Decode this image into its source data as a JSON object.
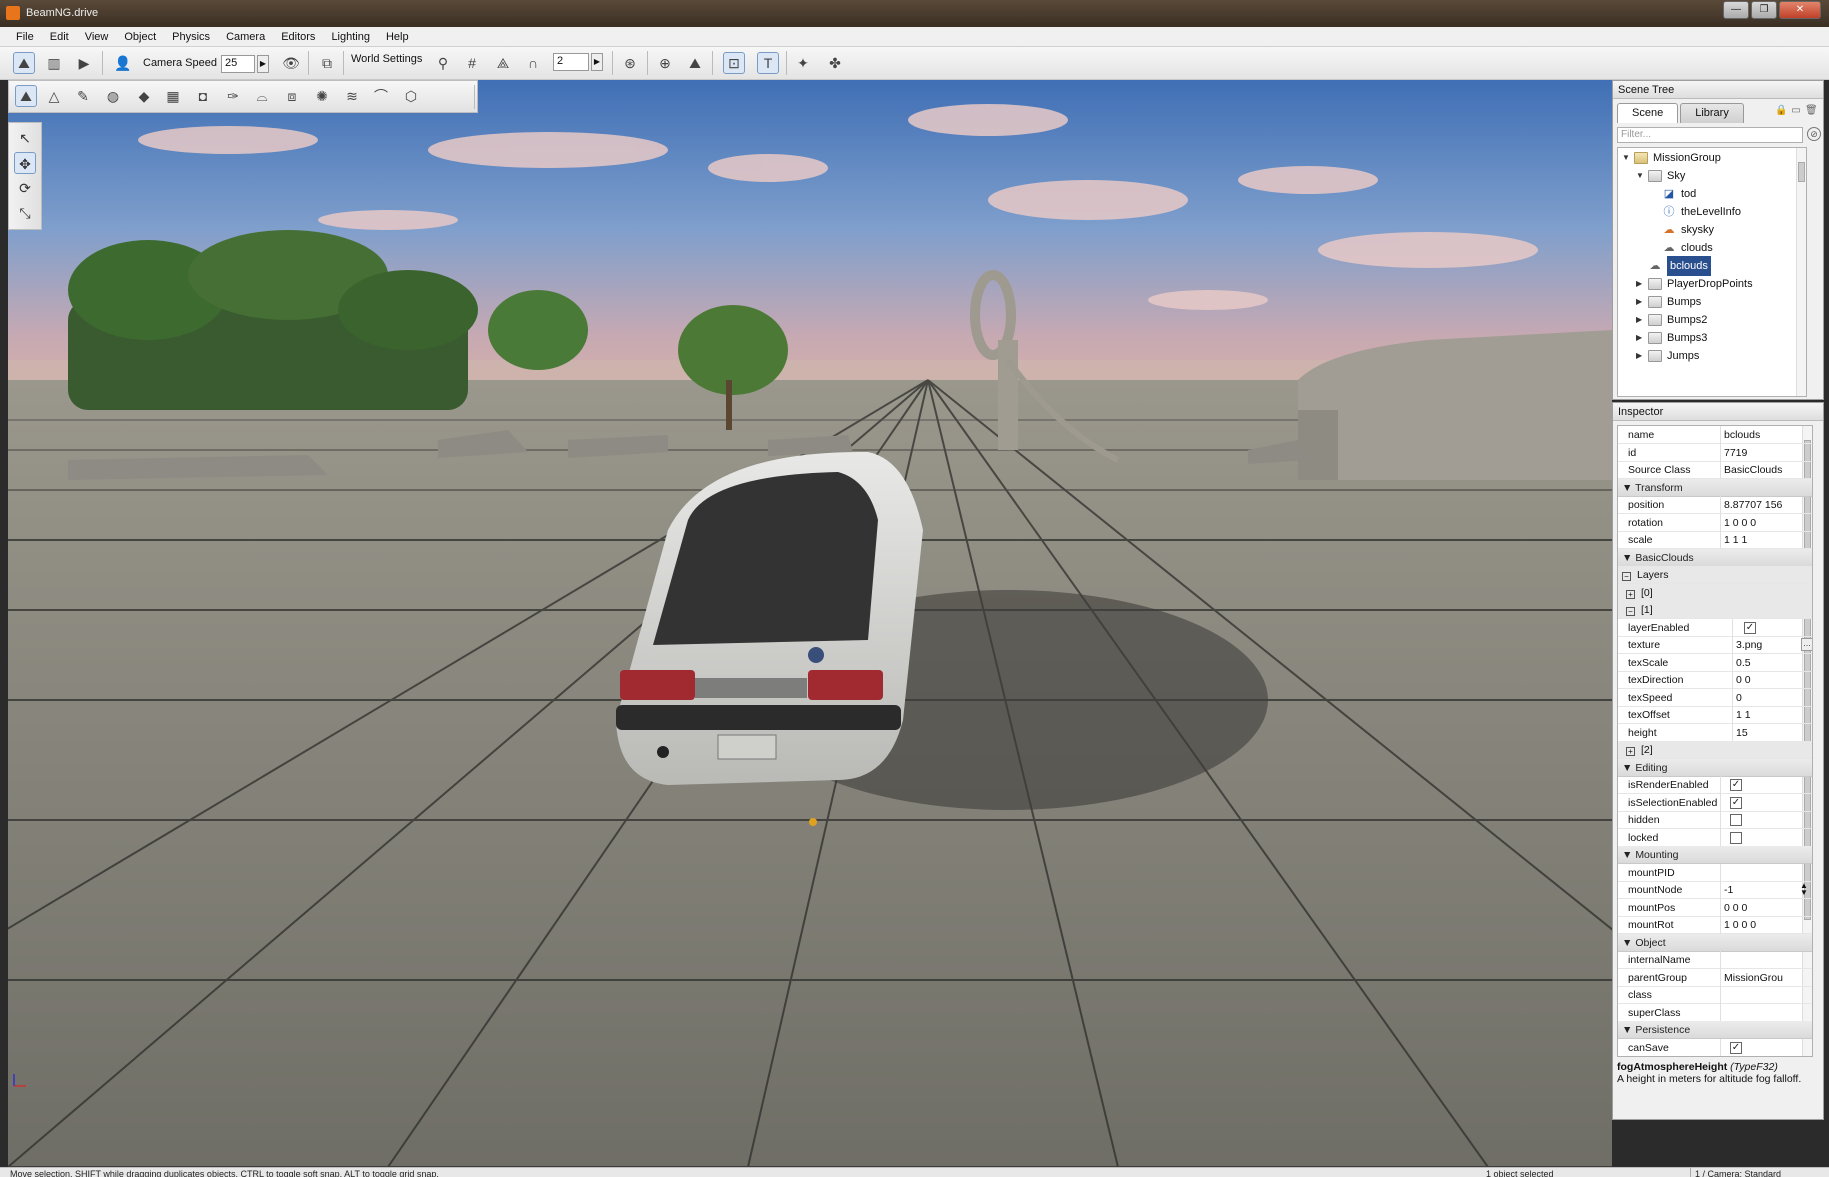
{
  "window": {
    "title": "BeamNG.drive",
    "min": "—",
    "max": "❐",
    "close": "✕"
  },
  "menu": [
    "File",
    "Edit",
    "View",
    "Object",
    "Physics",
    "Camera",
    "Editors",
    "Lighting",
    "Help"
  ],
  "toolbar": {
    "camera_speed_label": "Camera Speed",
    "camera_speed_value": "25",
    "world_settings_label": "World Settings",
    "grid_value": "2"
  },
  "scene_tree": {
    "title": "Scene Tree",
    "tabs": [
      "Scene",
      "Library"
    ],
    "filter_placeholder": "Filter...",
    "items": [
      {
        "label": "MissionGroup",
        "depth": 0,
        "expander": "▼",
        "icon": "folder-icon"
      },
      {
        "label": "Sky",
        "depth": 1,
        "expander": "▼",
        "icon": "folder-icon"
      },
      {
        "label": "tod",
        "depth": 2,
        "expander": "",
        "icon": "time-of-day-icon"
      },
      {
        "label": "theLevelInfo",
        "depth": 2,
        "expander": "",
        "icon": "info-icon"
      },
      {
        "label": "skysky",
        "depth": 2,
        "expander": "",
        "icon": "sky-icon"
      },
      {
        "label": "clouds",
        "depth": 2,
        "expander": "",
        "icon": "cloud-icon"
      },
      {
        "label": "bclouds",
        "depth": 1,
        "expander": "",
        "icon": "cloud-icon",
        "selected": true
      },
      {
        "label": "PlayerDropPoints",
        "depth": 1,
        "expander": "▶",
        "icon": "folder-icon"
      },
      {
        "label": "Bumps",
        "depth": 1,
        "expander": "▶",
        "icon": "folder-icon"
      },
      {
        "label": "Bumps2",
        "depth": 1,
        "expander": "▶",
        "icon": "folder-icon"
      },
      {
        "label": "Bumps3",
        "depth": 1,
        "expander": "▶",
        "icon": "folder-icon"
      },
      {
        "label": "Jumps",
        "depth": 1,
        "expander": "▶",
        "icon": "folder-icon"
      }
    ]
  },
  "inspector": {
    "title": "Inspector",
    "rows": [
      {
        "kind": "prop",
        "name": "name",
        "value": "bclouds"
      },
      {
        "kind": "prop",
        "name": "id",
        "value": "7719"
      },
      {
        "kind": "prop",
        "name": "Source Class",
        "value": "BasicClouds"
      },
      {
        "kind": "section",
        "name": "Transform"
      },
      {
        "kind": "prop",
        "name": "position",
        "value": "8.87707 156"
      },
      {
        "kind": "prop",
        "name": "rotation",
        "value": "1 0 0 0"
      },
      {
        "kind": "prop",
        "name": "scale",
        "value": "1 1 1"
      },
      {
        "kind": "section",
        "name": "BasicClouds"
      },
      {
        "kind": "group",
        "name": "Layers",
        "box": "−"
      },
      {
        "kind": "group",
        "name": "[0]",
        "box": "+",
        "indent": true
      },
      {
        "kind": "group",
        "name": "[1]",
        "box": "−",
        "indent": true
      },
      {
        "kind": "check",
        "name": "layerEnabled",
        "checked": true,
        "narrow": true
      },
      {
        "kind": "prop",
        "name": "texture",
        "value": "3.png",
        "narrow": true,
        "dots": true
      },
      {
        "kind": "prop",
        "name": "texScale",
        "value": "0.5",
        "narrow": true
      },
      {
        "kind": "prop",
        "name": "texDirection",
        "value": "0 0",
        "narrow": true
      },
      {
        "kind": "prop",
        "name": "texSpeed",
        "value": "0",
        "narrow": true
      },
      {
        "kind": "prop",
        "name": "texOffset",
        "value": "1 1",
        "narrow": true
      },
      {
        "kind": "prop",
        "name": "height",
        "value": "15",
        "narrow": true
      },
      {
        "kind": "group",
        "name": "[2]",
        "box": "+",
        "indent": true
      },
      {
        "kind": "section",
        "name": "Editing"
      },
      {
        "kind": "check",
        "name": "isRenderEnabled",
        "checked": true
      },
      {
        "kind": "check",
        "name": "isSelectionEnabled",
        "checked": true
      },
      {
        "kind": "check",
        "name": "hidden",
        "checked": false
      },
      {
        "kind": "check",
        "name": "locked",
        "checked": false
      },
      {
        "kind": "section",
        "name": "Mounting"
      },
      {
        "kind": "prop",
        "name": "mountPID",
        "value": ""
      },
      {
        "kind": "prop",
        "name": "mountNode",
        "value": "-1",
        "spin": true
      },
      {
        "kind": "prop",
        "name": "mountPos",
        "value": "0 0 0"
      },
      {
        "kind": "prop",
        "name": "mountRot",
        "value": "1 0 0 0"
      },
      {
        "kind": "section",
        "name": "Object"
      },
      {
        "kind": "prop",
        "name": "internalName",
        "value": ""
      },
      {
        "kind": "prop",
        "name": "parentGroup",
        "value": "MissionGrou"
      },
      {
        "kind": "prop",
        "name": "class",
        "value": ""
      },
      {
        "kind": "prop",
        "name": "superClass",
        "value": ""
      },
      {
        "kind": "section",
        "name": "Persistence"
      },
      {
        "kind": "check",
        "name": "canSave",
        "checked": true
      }
    ],
    "desc_name": "fogAtmosphereHeight",
    "desc_type": "(TypeF32)",
    "desc_text": "A height in meters for altitude fog falloff."
  },
  "status": {
    "left": "Move selection. SHIFT while dragging duplicates objects. CTRL to toggle soft snap. ALT to toggle grid snap.",
    "middle": "1 object selected",
    "right": "1 / Camera: Standard"
  }
}
